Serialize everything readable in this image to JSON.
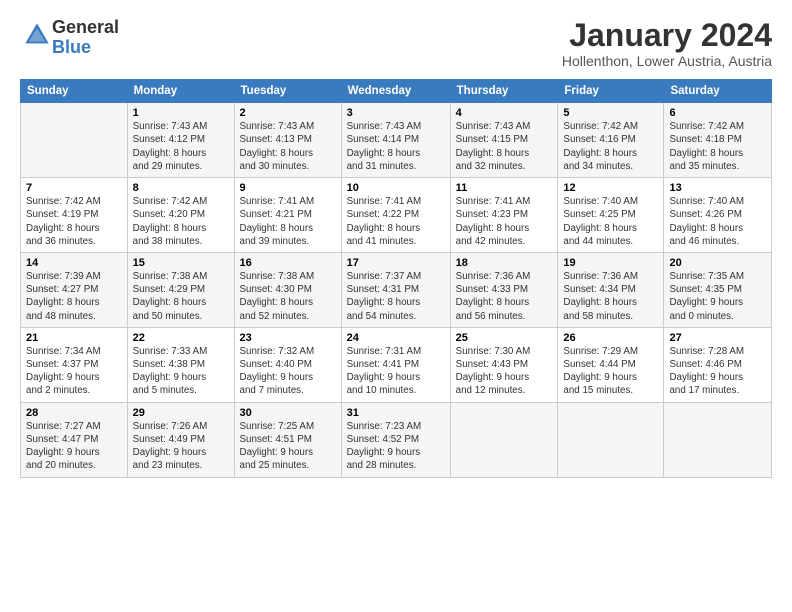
{
  "header": {
    "logo_general": "General",
    "logo_blue": "Blue",
    "month": "January 2024",
    "location": "Hollenthon, Lower Austria, Austria"
  },
  "days_of_week": [
    "Sunday",
    "Monday",
    "Tuesday",
    "Wednesday",
    "Thursday",
    "Friday",
    "Saturday"
  ],
  "weeks": [
    [
      {
        "day": "",
        "info": ""
      },
      {
        "day": "1",
        "info": "Sunrise: 7:43 AM\nSunset: 4:12 PM\nDaylight: 8 hours\nand 29 minutes."
      },
      {
        "day": "2",
        "info": "Sunrise: 7:43 AM\nSunset: 4:13 PM\nDaylight: 8 hours\nand 30 minutes."
      },
      {
        "day": "3",
        "info": "Sunrise: 7:43 AM\nSunset: 4:14 PM\nDaylight: 8 hours\nand 31 minutes."
      },
      {
        "day": "4",
        "info": "Sunrise: 7:43 AM\nSunset: 4:15 PM\nDaylight: 8 hours\nand 32 minutes."
      },
      {
        "day": "5",
        "info": "Sunrise: 7:42 AM\nSunset: 4:16 PM\nDaylight: 8 hours\nand 34 minutes."
      },
      {
        "day": "6",
        "info": "Sunrise: 7:42 AM\nSunset: 4:18 PM\nDaylight: 8 hours\nand 35 minutes."
      }
    ],
    [
      {
        "day": "7",
        "info": "Sunrise: 7:42 AM\nSunset: 4:19 PM\nDaylight: 8 hours\nand 36 minutes."
      },
      {
        "day": "8",
        "info": "Sunrise: 7:42 AM\nSunset: 4:20 PM\nDaylight: 8 hours\nand 38 minutes."
      },
      {
        "day": "9",
        "info": "Sunrise: 7:41 AM\nSunset: 4:21 PM\nDaylight: 8 hours\nand 39 minutes."
      },
      {
        "day": "10",
        "info": "Sunrise: 7:41 AM\nSunset: 4:22 PM\nDaylight: 8 hours\nand 41 minutes."
      },
      {
        "day": "11",
        "info": "Sunrise: 7:41 AM\nSunset: 4:23 PM\nDaylight: 8 hours\nand 42 minutes."
      },
      {
        "day": "12",
        "info": "Sunrise: 7:40 AM\nSunset: 4:25 PM\nDaylight: 8 hours\nand 44 minutes."
      },
      {
        "day": "13",
        "info": "Sunrise: 7:40 AM\nSunset: 4:26 PM\nDaylight: 8 hours\nand 46 minutes."
      }
    ],
    [
      {
        "day": "14",
        "info": "Sunrise: 7:39 AM\nSunset: 4:27 PM\nDaylight: 8 hours\nand 48 minutes."
      },
      {
        "day": "15",
        "info": "Sunrise: 7:38 AM\nSunset: 4:29 PM\nDaylight: 8 hours\nand 50 minutes."
      },
      {
        "day": "16",
        "info": "Sunrise: 7:38 AM\nSunset: 4:30 PM\nDaylight: 8 hours\nand 52 minutes."
      },
      {
        "day": "17",
        "info": "Sunrise: 7:37 AM\nSunset: 4:31 PM\nDaylight: 8 hours\nand 54 minutes."
      },
      {
        "day": "18",
        "info": "Sunrise: 7:36 AM\nSunset: 4:33 PM\nDaylight: 8 hours\nand 56 minutes."
      },
      {
        "day": "19",
        "info": "Sunrise: 7:36 AM\nSunset: 4:34 PM\nDaylight: 8 hours\nand 58 minutes."
      },
      {
        "day": "20",
        "info": "Sunrise: 7:35 AM\nSunset: 4:35 PM\nDaylight: 9 hours\nand 0 minutes."
      }
    ],
    [
      {
        "day": "21",
        "info": "Sunrise: 7:34 AM\nSunset: 4:37 PM\nDaylight: 9 hours\nand 2 minutes."
      },
      {
        "day": "22",
        "info": "Sunrise: 7:33 AM\nSunset: 4:38 PM\nDaylight: 9 hours\nand 5 minutes."
      },
      {
        "day": "23",
        "info": "Sunrise: 7:32 AM\nSunset: 4:40 PM\nDaylight: 9 hours\nand 7 minutes."
      },
      {
        "day": "24",
        "info": "Sunrise: 7:31 AM\nSunset: 4:41 PM\nDaylight: 9 hours\nand 10 minutes."
      },
      {
        "day": "25",
        "info": "Sunrise: 7:30 AM\nSunset: 4:43 PM\nDaylight: 9 hours\nand 12 minutes."
      },
      {
        "day": "26",
        "info": "Sunrise: 7:29 AM\nSunset: 4:44 PM\nDaylight: 9 hours\nand 15 minutes."
      },
      {
        "day": "27",
        "info": "Sunrise: 7:28 AM\nSunset: 4:46 PM\nDaylight: 9 hours\nand 17 minutes."
      }
    ],
    [
      {
        "day": "28",
        "info": "Sunrise: 7:27 AM\nSunset: 4:47 PM\nDaylight: 9 hours\nand 20 minutes."
      },
      {
        "day": "29",
        "info": "Sunrise: 7:26 AM\nSunset: 4:49 PM\nDaylight: 9 hours\nand 23 minutes."
      },
      {
        "day": "30",
        "info": "Sunrise: 7:25 AM\nSunset: 4:51 PM\nDaylight: 9 hours\nand 25 minutes."
      },
      {
        "day": "31",
        "info": "Sunrise: 7:23 AM\nSunset: 4:52 PM\nDaylight: 9 hours\nand 28 minutes."
      },
      {
        "day": "",
        "info": ""
      },
      {
        "day": "",
        "info": ""
      },
      {
        "day": "",
        "info": ""
      }
    ]
  ]
}
